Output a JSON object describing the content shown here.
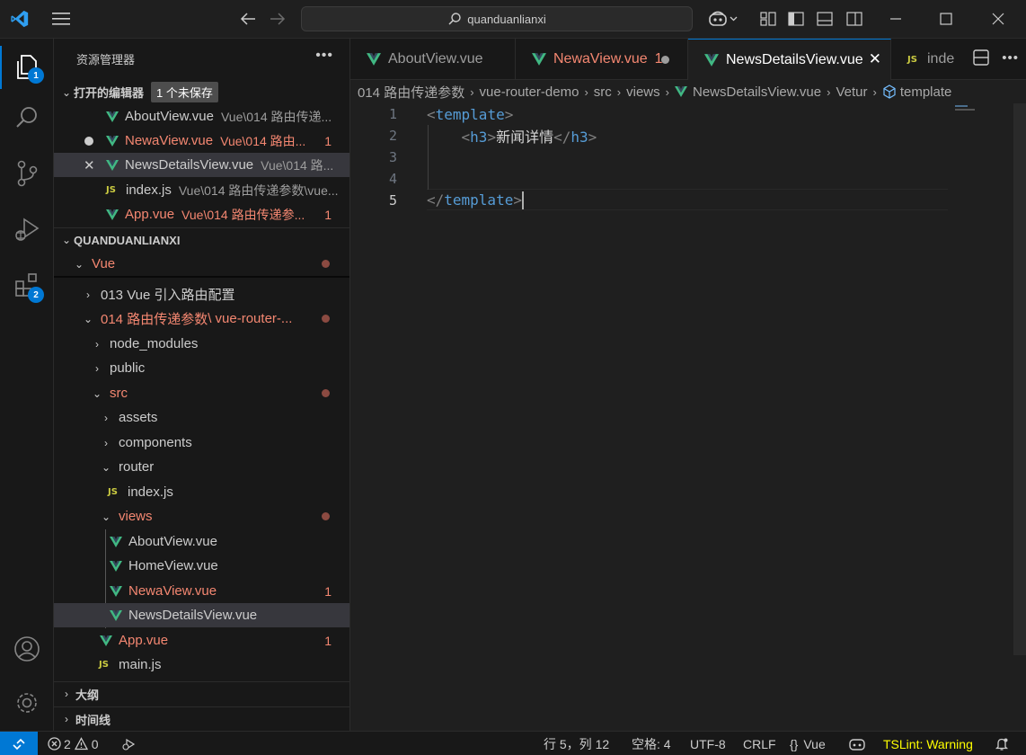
{
  "titlebar": {
    "search_text": "quanduanlianxi"
  },
  "activity": {
    "explorer_badge": "1",
    "extensions_badge": "2"
  },
  "sidebar": {
    "title": "资源管理器",
    "open_editors": {
      "title": "打开的编辑器",
      "unsaved_pill": "1 个未保存",
      "items": [
        {
          "name": "AboutView.vue",
          "desc": "Vue\\014 路由传递...",
          "count": ""
        },
        {
          "name": "NewaView.vue",
          "desc": "Vue\\014 路由...",
          "count": "1"
        },
        {
          "name": "NewsDetailsView.vue",
          "desc": "Vue\\014 路...",
          "count": ""
        },
        {
          "name": "index.js",
          "desc": "Vue\\014 路由传递参数\\vue...",
          "count": ""
        },
        {
          "name": "App.vue",
          "desc": "Vue\\014 路由传递参...",
          "count": "1"
        }
      ]
    },
    "workspace": {
      "title": "QUANDUANLIANXI",
      "items": [
        {
          "label": "Vue"
        },
        {
          "label": "013 Vue 引入路由配置"
        },
        {
          "label": "014 路由传递参数",
          "suffix": "\\ vue-router-..."
        },
        {
          "label": "node_modules"
        },
        {
          "label": "public"
        },
        {
          "label": "src"
        },
        {
          "label": "assets"
        },
        {
          "label": "components"
        },
        {
          "label": "router"
        },
        {
          "label": "index.js"
        },
        {
          "label": "views"
        },
        {
          "label": "AboutView.vue"
        },
        {
          "label": "HomeView.vue"
        },
        {
          "label": "NewaView.vue",
          "count": "1"
        },
        {
          "label": "NewsDetailsView.vue"
        },
        {
          "label": "App.vue",
          "count": "1"
        },
        {
          "label": "main.js"
        }
      ]
    },
    "outline_title": "大纲",
    "timeline_title": "时间线"
  },
  "tabs": [
    {
      "label": "AboutView.vue"
    },
    {
      "label": "NewaView.vue",
      "count": "1"
    },
    {
      "label": "NewsDetailsView.vue"
    },
    {
      "label": "inde"
    }
  ],
  "breadcrumb": [
    "014 路由传递参数",
    "vue-router-demo",
    "src",
    "views",
    "NewsDetailsView.vue",
    "Vetur",
    "template"
  ],
  "editor": {
    "line_numbers": [
      "1",
      "2",
      "3",
      "4",
      "5"
    ],
    "line1_tag": "template",
    "line2_tag": "h3",
    "line2_text": "新闻详情",
    "line5_tag": "template"
  },
  "statusbar": {
    "errors": "2",
    "warnings": "0",
    "position": "行 5，列 12",
    "spaces": "空格: 4",
    "encoding": "UTF-8",
    "eol": "CRLF",
    "language": "Vue",
    "tslint": "TSLint: Warning"
  }
}
